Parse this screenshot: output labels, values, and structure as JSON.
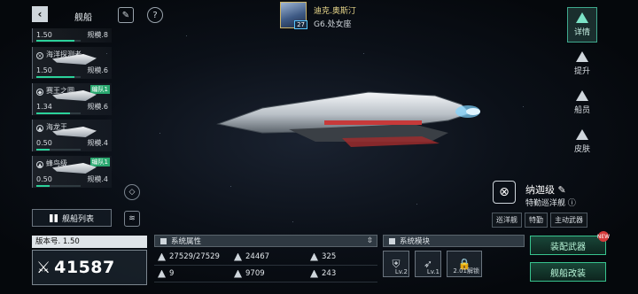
{
  "topbar": {
    "title": "舰船",
    "back_icon": "back-chevron-icon",
    "captain": {
      "name": "迪克.奥斯汀",
      "star": "G6.处女座",
      "level": "27"
    }
  },
  "ship_list": [
    {
      "name": "",
      "value": "1.50",
      "scale": "规模.8",
      "progress": 0.85,
      "tag": ""
    },
    {
      "name": "海洋探测者",
      "value": "1.50",
      "scale": "规模.6",
      "progress": 0.85,
      "tag": ""
    },
    {
      "name": "赛王之圆",
      "value": "1.34",
      "scale": "规模.6",
      "progress": 0.75,
      "tag": "编队1"
    },
    {
      "name": "海龙王",
      "value": "0.50",
      "scale": "规模.4",
      "progress": 0.3,
      "tag": ""
    },
    {
      "name": "蜂鸟级",
      "value": "0.50",
      "scale": "规模.4",
      "progress": 0.3,
      "tag": "编队1"
    }
  ],
  "fleet_button": "舰船列表",
  "right_nav": [
    {
      "label": "详情",
      "active": true
    },
    {
      "label": "提升",
      "active": false
    },
    {
      "label": "船员",
      "active": false
    },
    {
      "label": "皮肤",
      "active": false
    }
  ],
  "ship_class": {
    "name": "纳迦级",
    "type": "特勤巡洋舰",
    "tags": [
      "巡洋舰",
      "特勤",
      "主动武器"
    ]
  },
  "version": {
    "label": "版本号. 1.50"
  },
  "power": {
    "value": "41587"
  },
  "attributes": {
    "title": "系统属性",
    "items": [
      "27529/27529",
      "24467",
      "325",
      "9",
      "9709",
      "243"
    ]
  },
  "modules": {
    "title": "系统模块",
    "slots": [
      {
        "level": "Lv.2"
      },
      {
        "level": "Lv.1"
      },
      {
        "level": "2.01解锁"
      }
    ]
  },
  "actions": {
    "equip": "装配武器",
    "modify": "舰船改装",
    "new_badge": "NEW"
  },
  "colors": {
    "accent": "#2bd19a",
    "tag_green": "#2aa86f",
    "active_nav": "#3fa98e",
    "badge": "#d43a3a"
  }
}
